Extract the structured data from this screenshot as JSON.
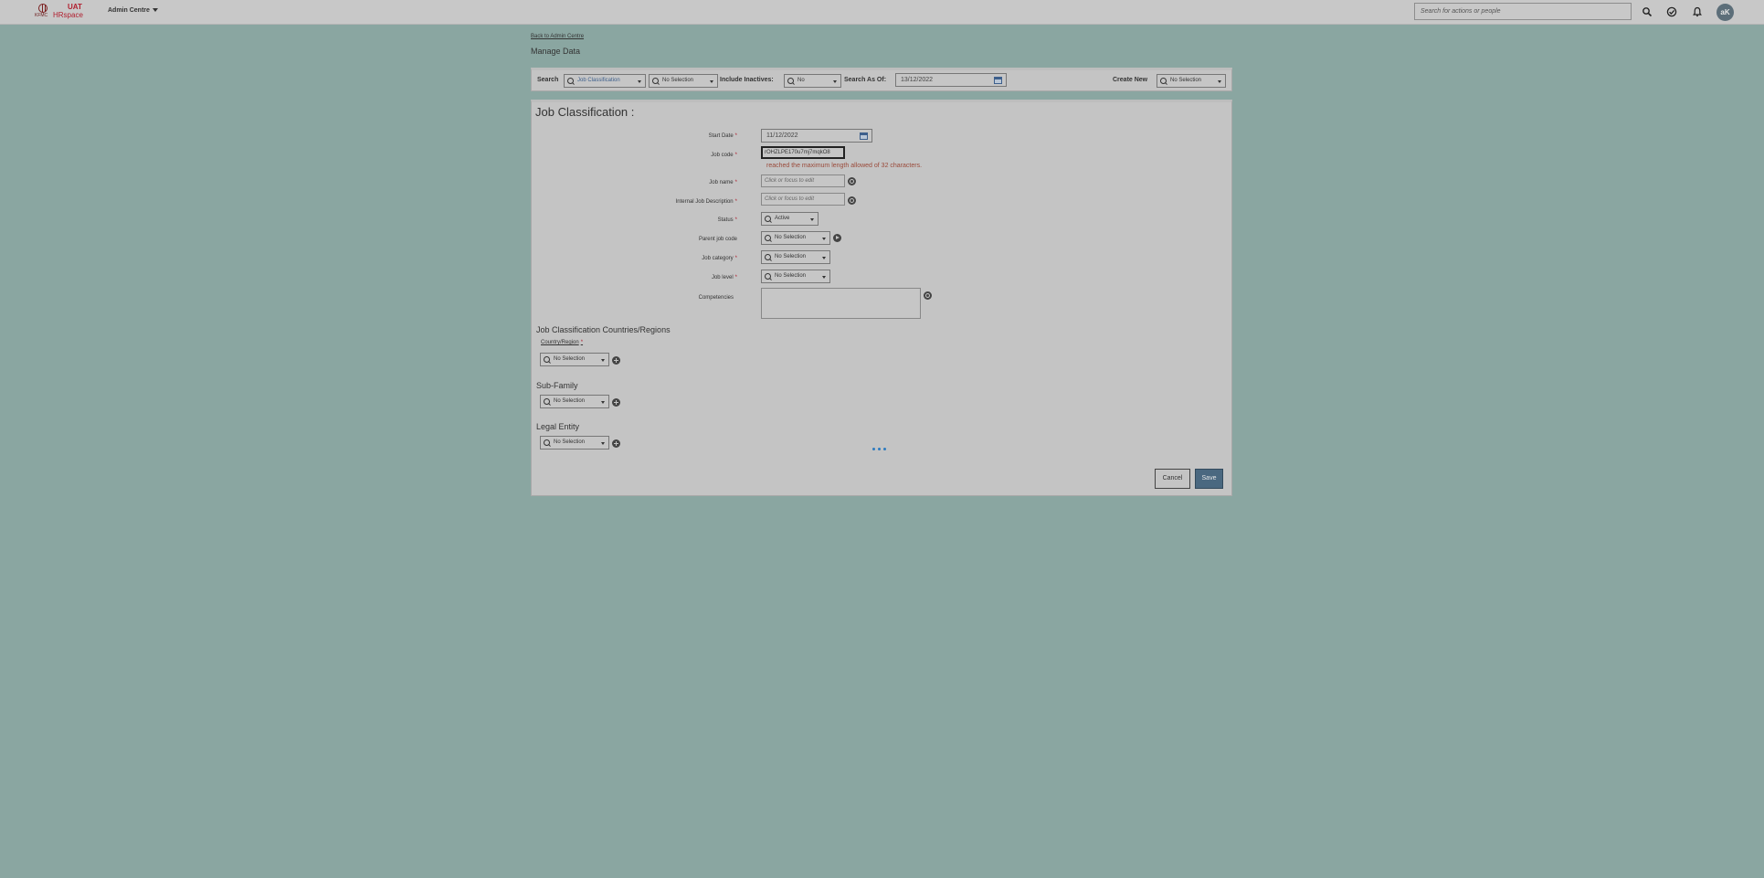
{
  "topbar": {
    "logo": {
      "small_text": "KFMC",
      "uat": "UAT",
      "brand": "HRspace"
    },
    "menu_label": "Admin Centre",
    "search_placeholder": "Search for actions or people",
    "avatar_initials": "aK"
  },
  "page": {
    "back_link": "Back to Admin Centre",
    "title": "Manage Data"
  },
  "search_bar": {
    "search_label": "Search",
    "search_type": "Job Classification",
    "search_value": "No Selection",
    "include_inactives_label": "Include Inactives:",
    "include_inactives_value": "No",
    "search_as_of_label": "Search As Of:",
    "search_as_of_value": "13/12/2022",
    "create_new_label": "Create New",
    "create_new_value": "No Selection"
  },
  "form": {
    "title": "Job Classification :",
    "fields": {
      "start_date": {
        "label": "Start Date",
        "value": "11/12/2022"
      },
      "job_code": {
        "label": "Job code",
        "value": "rOHZLPE170u7mj7mqkO8",
        "error": "reached the maximum length allowed of 32 characters."
      },
      "job_name": {
        "label": "Job name",
        "placeholder": "Click or focus to edit"
      },
      "internal_desc": {
        "label": "Internal Job Description",
        "placeholder": "Click or focus to edit"
      },
      "status": {
        "label": "Status",
        "value": "Active"
      },
      "parent_job_code": {
        "label": "Parent job code",
        "value": "No Selection"
      },
      "job_category": {
        "label": "Job category",
        "value": "No Selection"
      },
      "job_level": {
        "label": "Job level",
        "value": "No Selection"
      },
      "competencies": {
        "label": "Competencies"
      }
    },
    "sections": {
      "countries": {
        "title": "Job Classification Countries/Regions",
        "column": "Country/Region",
        "value": "No Selection"
      },
      "sub_family": {
        "title": "Sub-Family",
        "value": "No Selection"
      },
      "legal_entity": {
        "title": "Legal Entity",
        "value": "No Selection"
      }
    },
    "required_marker": "*",
    "buttons": {
      "cancel": "Cancel",
      "save": "Save"
    }
  }
}
